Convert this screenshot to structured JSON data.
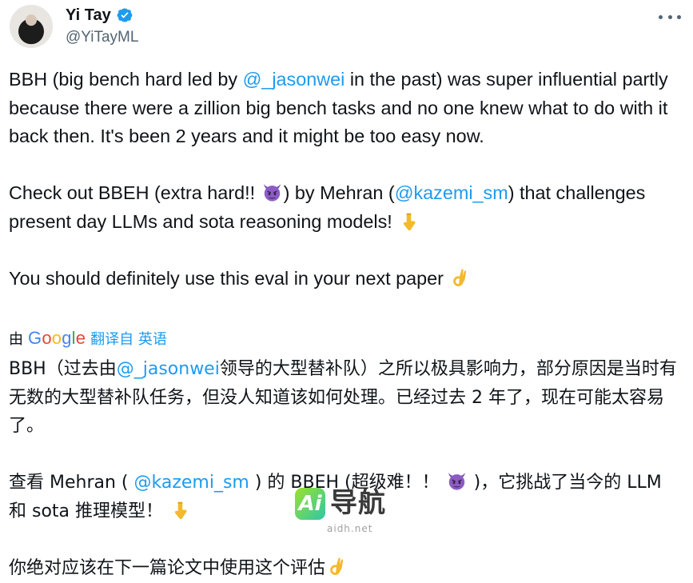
{
  "author": {
    "name": "Yi Tay",
    "handle": "@YiTayML"
  },
  "tweet": {
    "p1_a": "BBH (big bench hard led by ",
    "p1_mention": "@_jasonwei",
    "p1_b": " in the past) was super influential partly because there were a zillion big bench tasks and no one knew what to do with it back then. It's been 2 years and it might be too easy now.",
    "p2_a": "Check out BBEH (extra hard!! ",
    "p2_b": ") by Mehran (",
    "p2_mention": "@kazemi_sm",
    "p2_c": ") that challenges present day LLMs and sota reasoning models! ",
    "p3": "You should definitely use this eval in your next paper "
  },
  "translation": {
    "prefix": "由",
    "logo": "Google",
    "link": "翻译自 英语"
  },
  "translated": {
    "p1_a": "BBH（过去由",
    "p1_mention": "@_jasonwei",
    "p1_b": "领导的大型替补队）之所以极具影响力，部分原因是当时有无数的大型替补队任务，但没人知道该如何处理。已经过去 2 年了，现在可能太容易了。",
    "p2_a": "查看 Mehran ( ",
    "p2_mention": "@kazemi_sm",
    "p2_b": " ) 的 BBEH (超级难！！ ",
    "p2_c": " )，它挑战了当今的 LLM 和 sota 推理模型！ ",
    "p3": "你绝对应该在下一篇论文中使用这个评估"
  },
  "watermark": {
    "badge": "Ai",
    "text": "导航",
    "url": "aidh.net"
  },
  "icons": {
    "verified": "verified-badge-icon",
    "more": "more-options-icon",
    "devil": "smiling-imp-emoji",
    "point_down": "point-down-emoji",
    "ok_hand": "ok-hand-emoji"
  },
  "colors": {
    "mention": "#1d9bf0",
    "text": "#0f1419",
    "secondary": "#536471"
  }
}
